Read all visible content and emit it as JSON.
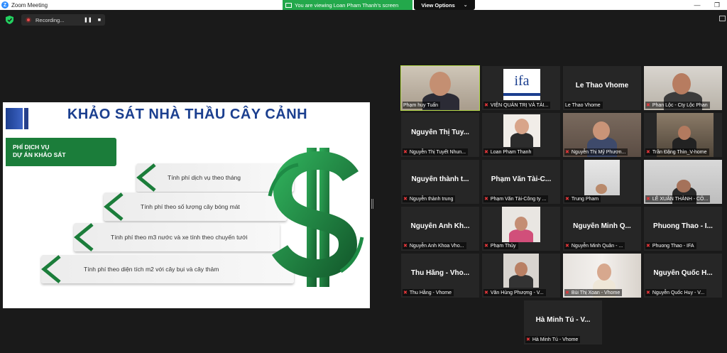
{
  "window": {
    "title": "Zoom Meeting",
    "minimize": "—",
    "restore": "❐",
    "logo": "Z"
  },
  "share_banner": {
    "text": "You are viewing Loan Pham Thanh's screen",
    "view_options": "View Options",
    "chevron": "⌄"
  },
  "recording": {
    "label": "Recording...",
    "pause": "❚❚",
    "stop": "■"
  },
  "slide": {
    "title": "KHẢO SÁT NHÀ THẦU CÂY CẢNH",
    "tab_line1": "PHÍ DỊCH VỤ",
    "tab_line2": "DỰ ÁN KHẢO SÁT",
    "steps": [
      "Tính phí dịch vụ theo tháng",
      "Tính phí theo số lượng cây bóng mát",
      "Tính phí theo m3 nước và xe tính theo chuyến tưới",
      "Tính phí theo diện tích m2 với cây bụi và cây thảm"
    ]
  },
  "colors": {
    "accent_green": "#1b7d3a",
    "banner_green": "#23a84b",
    "title_blue": "#1b3f8f",
    "active_border": "#b6d94a",
    "mic_muted": "#e5373a"
  },
  "participants": [
    {
      "label": "Phạm huy Tuấn",
      "big": "",
      "muted": false,
      "video": true
    },
    {
      "label": "VIỆN QUẢN TRỊ VÀ TÀI...",
      "big": "ifa",
      "muted": true,
      "video": true
    },
    {
      "label": "Le Thao Vhome",
      "big": "Le Thao Vhome",
      "muted": false,
      "video": false
    },
    {
      "label": "Phan Lộc - Cty Lộc Phan",
      "big": "",
      "muted": true,
      "video": true
    },
    {
      "label": "Nguyễn Thị Tuyết Nhun...",
      "big": "Nguyễn Thị Tuy...",
      "muted": true,
      "video": false
    },
    {
      "label": "Loan Pham Thanh",
      "big": "",
      "muted": true,
      "video": true
    },
    {
      "label": "Nguyễn Thị Mỹ Phươn...",
      "big": "",
      "muted": true,
      "video": true
    },
    {
      "label": "Trần Đặng Thìn_V-home",
      "big": "",
      "muted": true,
      "video": true
    },
    {
      "label": "Nguyễn thành trung",
      "big": "Nguyễn thành t...",
      "muted": true,
      "video": false
    },
    {
      "label": "Phạm Văn Tài-Công ty ...",
      "big": "Phạm Văn Tài-C...",
      "muted": true,
      "video": false
    },
    {
      "label": "Trung Pham",
      "big": "",
      "muted": true,
      "video": true
    },
    {
      "label": "LÊ XUÂN THÀNH - CÔ...",
      "big": "",
      "muted": true,
      "video": true
    },
    {
      "label": "Nguyễn Anh Khoa Vho...",
      "big": "Nguyễn Anh Kh...",
      "muted": true,
      "video": false
    },
    {
      "label": "Phạm Thủy",
      "big": "",
      "muted": true,
      "video": true
    },
    {
      "label": "Nguyễn Minh Quân - ...",
      "big": "Nguyễn Minh Q...",
      "muted": true,
      "video": false
    },
    {
      "label": "Phuong Thao - IFA",
      "big": "Phuong Thao - I...",
      "muted": true,
      "video": false
    },
    {
      "label": "Thu Hằng - Vhome",
      "big": "Thu Hằng - Vho...",
      "muted": true,
      "video": false
    },
    {
      "label": "Văn Hùng Phượng - V...",
      "big": "",
      "muted": true,
      "video": true
    },
    {
      "label": "Bùi Thị Xoan - Vhome",
      "big": "",
      "muted": true,
      "video": true
    },
    {
      "label": "Nguyễn Quốc Huy - V...",
      "big": "Nguyễn Quốc H...",
      "muted": true,
      "video": false
    },
    {
      "label": "Hà Minh Tú - Vhome",
      "big": "Hà Minh Tú - V...",
      "muted": true,
      "video": false
    }
  ]
}
